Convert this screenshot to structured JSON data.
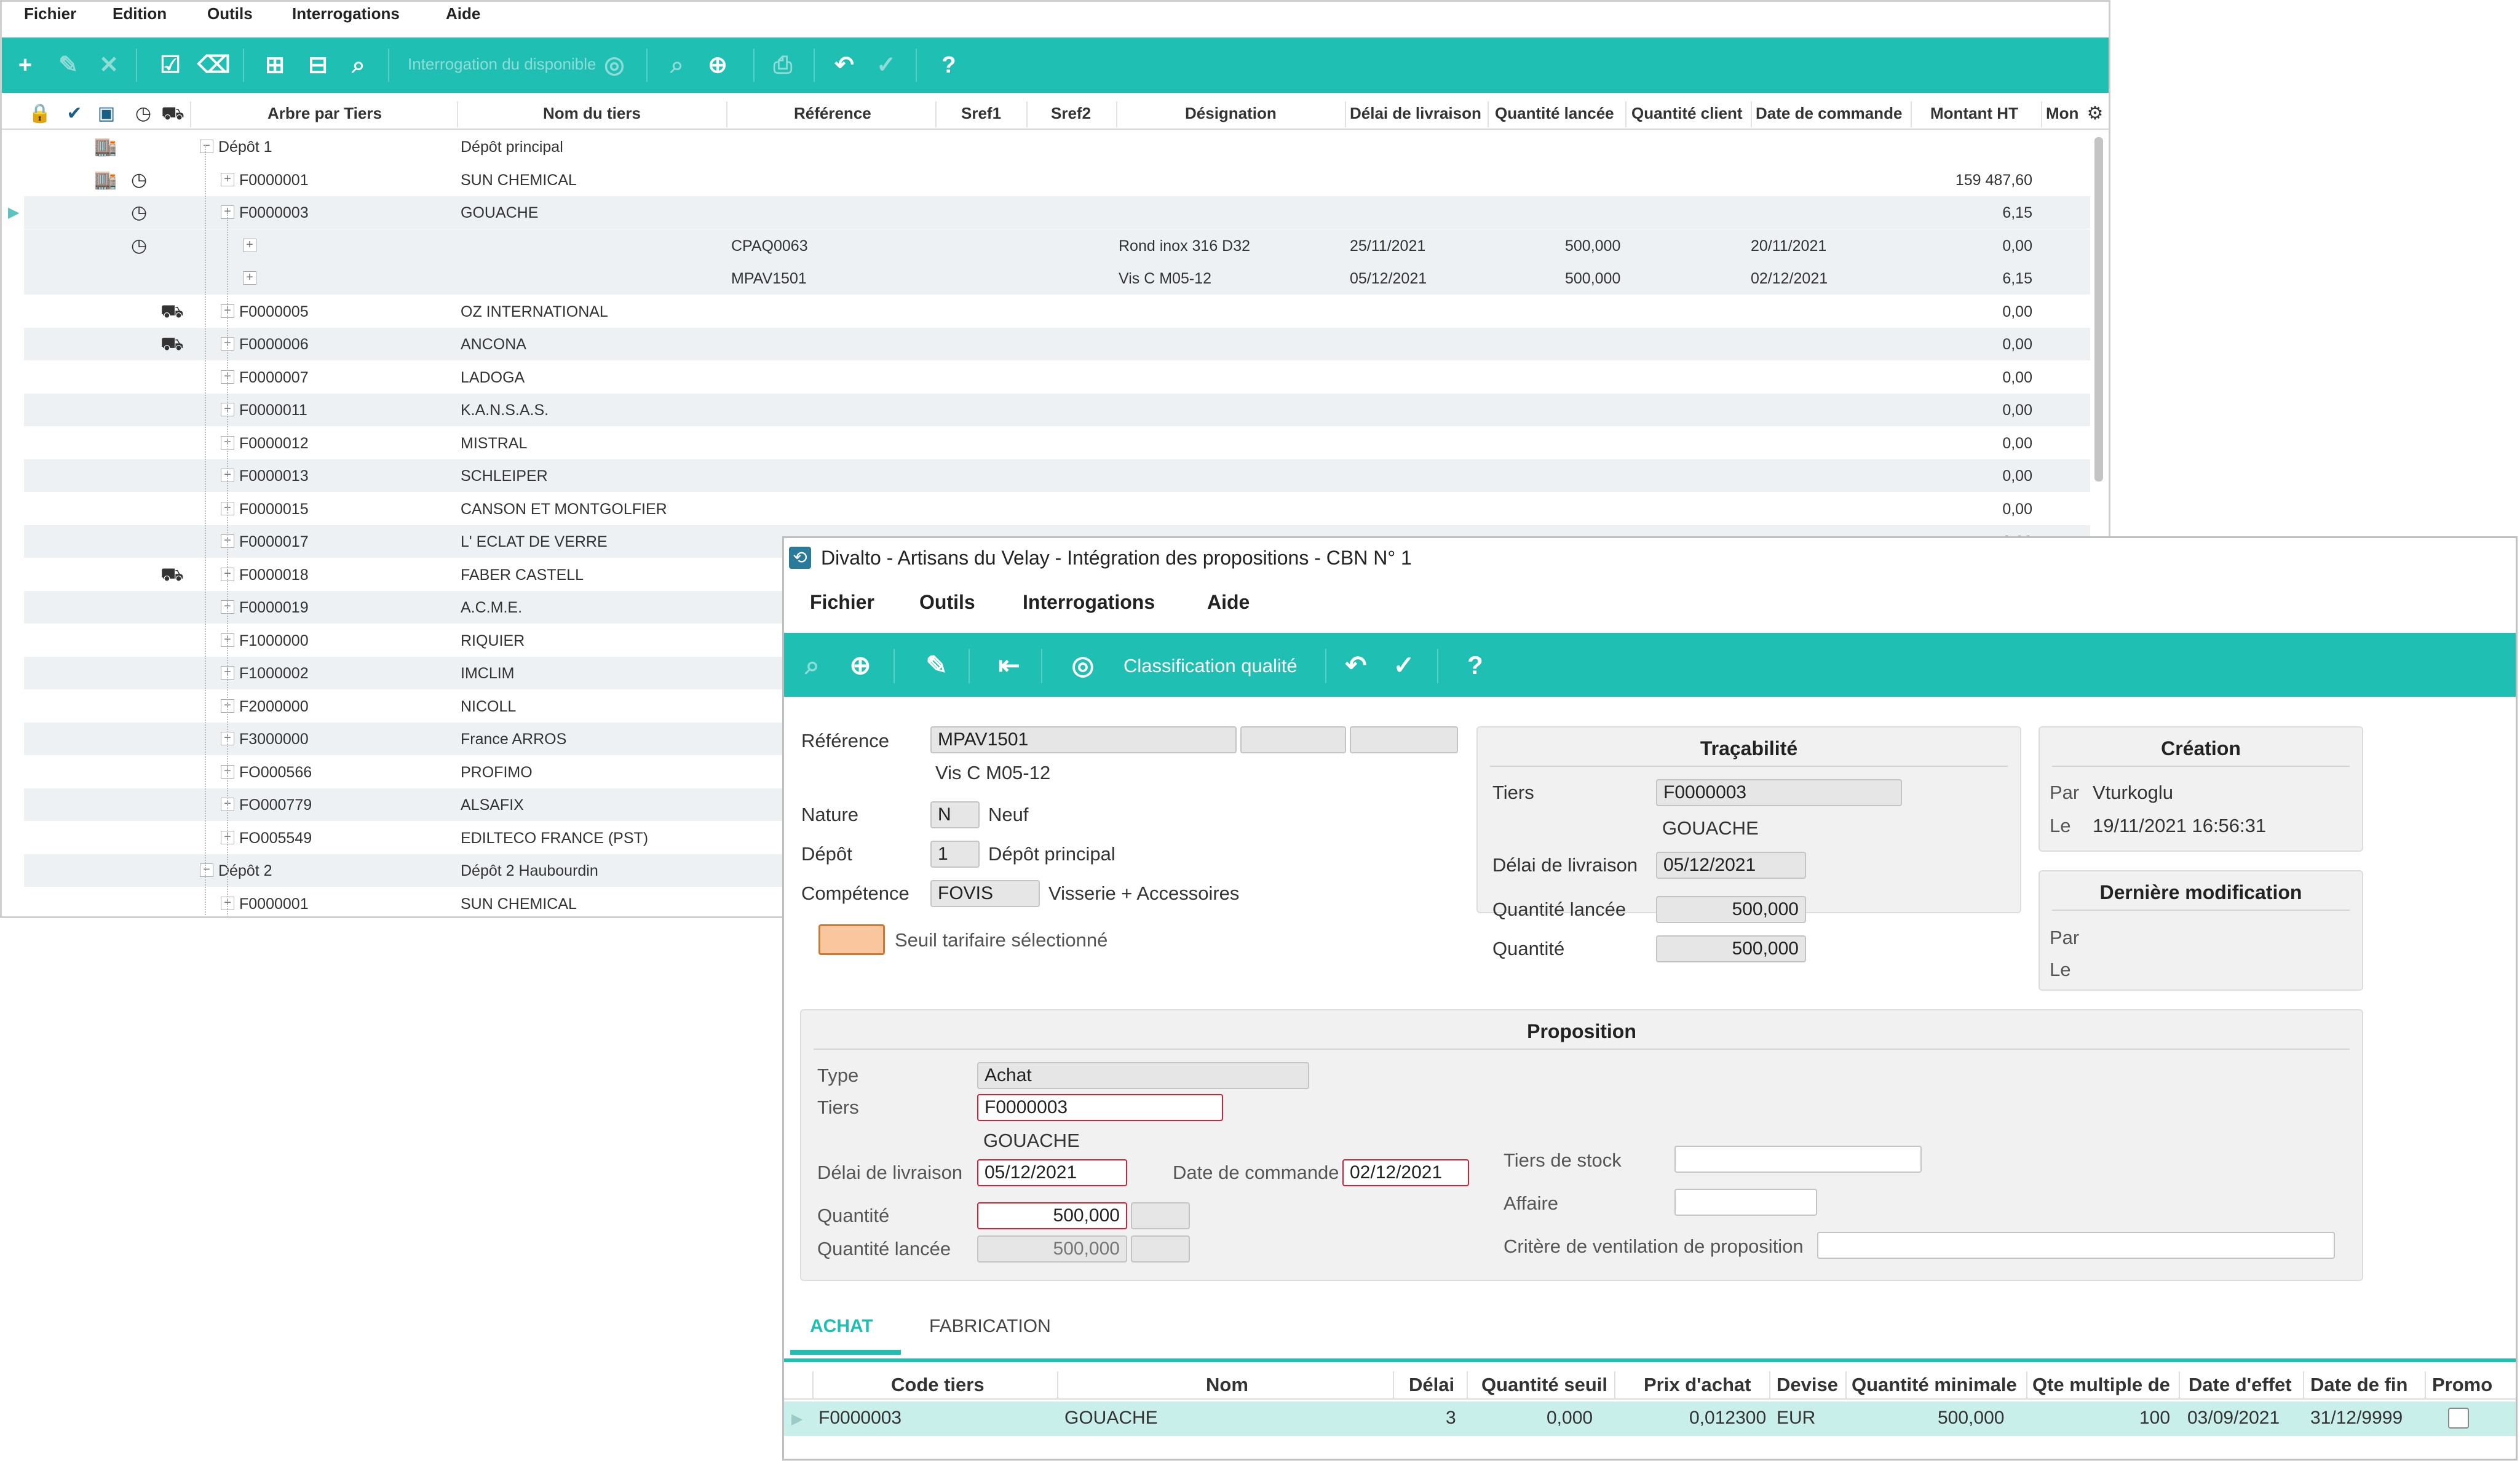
{
  "main_menu": [
    "Fichier",
    "Edition",
    "Outils",
    "Interrogations",
    "Aide"
  ],
  "main_toolbar": {
    "interrogation_label": "Interrogation du disponible"
  },
  "grid": {
    "columns": [
      "Arbre par Tiers",
      "Nom du tiers",
      "Référence",
      "Sref1",
      "Sref2",
      "Désignation",
      "Délai de livraison",
      "Quantité lancée",
      "Quantité client",
      "Date de commande",
      "Montant HT",
      "Mon"
    ],
    "rows": [
      {
        "code": "Dépôt 1",
        "name": "Dépôt principal",
        "ref": "",
        "des": "",
        "delai": "",
        "qte": "",
        "datecmd": "",
        "montant": ""
      },
      {
        "code": "F0000001",
        "name": "SUN CHEMICAL",
        "ref": "",
        "des": "",
        "delai": "",
        "qte": "",
        "datecmd": "",
        "montant": "159 487,60"
      },
      {
        "code": "F0000003",
        "name": "GOUACHE",
        "ref": "",
        "des": "",
        "delai": "",
        "qte": "",
        "datecmd": "",
        "montant": "6,15"
      },
      {
        "code": "",
        "name": "",
        "ref": "CPAQ0063",
        "des": "Rond inox 316 D32",
        "delai": "25/11/2021",
        "qte": "500,000",
        "datecmd": "20/11/2021",
        "montant": "0,00"
      },
      {
        "code": "",
        "name": "",
        "ref": "MPAV1501",
        "des": "Vis C M05-12",
        "delai": "05/12/2021",
        "qte": "500,000",
        "datecmd": "02/12/2021",
        "montant": "6,15"
      },
      {
        "code": "F0000005",
        "name": "OZ INTERNATIONAL",
        "ref": "",
        "des": "",
        "delai": "",
        "qte": "",
        "datecmd": "",
        "montant": "0,00"
      },
      {
        "code": "F0000006",
        "name": "ANCONA",
        "ref": "",
        "des": "",
        "delai": "",
        "qte": "",
        "datecmd": "",
        "montant": "0,00"
      },
      {
        "code": "F0000007",
        "name": "LADOGA",
        "ref": "",
        "des": "",
        "delai": "",
        "qte": "",
        "datecmd": "",
        "montant": "0,00"
      },
      {
        "code": "F0000011",
        "name": "K.A.N.S.A.S.",
        "ref": "",
        "des": "",
        "delai": "",
        "qte": "",
        "datecmd": "",
        "montant": "0,00"
      },
      {
        "code": "F0000012",
        "name": "MISTRAL",
        "ref": "",
        "des": "",
        "delai": "",
        "qte": "",
        "datecmd": "",
        "montant": "0,00"
      },
      {
        "code": "F0000013",
        "name": "SCHLEIPER",
        "ref": "",
        "des": "",
        "delai": "",
        "qte": "",
        "datecmd": "",
        "montant": "0,00"
      },
      {
        "code": "F0000015",
        "name": "CANSON ET MONTGOLFIER",
        "ref": "",
        "des": "",
        "delai": "",
        "qte": "",
        "datecmd": "",
        "montant": "0,00"
      },
      {
        "code": "F0000017",
        "name": "L' ECLAT DE VERRE",
        "ref": "",
        "des": "",
        "delai": "",
        "qte": "",
        "datecmd": "",
        "montant": "0,00"
      },
      {
        "code": "F0000018",
        "name": "FABER CASTELL",
        "ref": "",
        "des": "",
        "delai": "",
        "qte": "",
        "datecmd": "",
        "montant": ""
      },
      {
        "code": "F0000019",
        "name": "A.C.M.E.",
        "ref": "",
        "des": "",
        "delai": "",
        "qte": "",
        "datecmd": "",
        "montant": ""
      },
      {
        "code": "F1000000",
        "name": "RIQUIER",
        "ref": "",
        "des": "",
        "delai": "",
        "qte": "",
        "datecmd": "",
        "montant": ""
      },
      {
        "code": "F1000002",
        "name": "IMCLIM",
        "ref": "",
        "des": "",
        "delai": "",
        "qte": "",
        "datecmd": "",
        "montant": ""
      },
      {
        "code": "F2000000",
        "name": "NICOLL",
        "ref": "",
        "des": "",
        "delai": "",
        "qte": "",
        "datecmd": "",
        "montant": ""
      },
      {
        "code": "F3000000",
        "name": "France ARROS",
        "ref": "",
        "des": "",
        "delai": "",
        "qte": "",
        "datecmd": "",
        "montant": ""
      },
      {
        "code": "FO000566",
        "name": "PROFIMO",
        "ref": "",
        "des": "",
        "delai": "",
        "qte": "",
        "datecmd": "",
        "montant": ""
      },
      {
        "code": "FO000779",
        "name": "ALSAFIX",
        "ref": "",
        "des": "",
        "delai": "",
        "qte": "",
        "datecmd": "",
        "montant": ""
      },
      {
        "code": "FO005549",
        "name": "EDILTECO FRANCE (PST)",
        "ref": "",
        "des": "",
        "delai": "",
        "qte": "",
        "datecmd": "",
        "montant": ""
      },
      {
        "code": "Dépôt 2",
        "name": "Dépôt 2 Haubourdin",
        "ref": "",
        "des": "",
        "delai": "",
        "qte": "",
        "datecmd": "",
        "montant": ""
      },
      {
        "code": "F0000001",
        "name": "SUN CHEMICAL",
        "ref": "",
        "des": "",
        "delai": "",
        "qte": "",
        "datecmd": "",
        "montant": ""
      }
    ]
  },
  "dialog": {
    "title": "Divalto - Artisans du Velay - Intégration des propositions - CBN N° 1",
    "menu": [
      "Fichier",
      "Outils",
      "Interrogations",
      "Aide"
    ],
    "toolbar_label": "Classification qualité",
    "reference_label": "Référence",
    "reference_value": "MPAV1501",
    "designation": "Vis C M05-12",
    "nature_label": "Nature",
    "nature_code": "N",
    "nature_text": "Neuf",
    "depot_label": "Dépôt",
    "depot_code": "1",
    "depot_text": "Dépôt principal",
    "competence_label": "Compétence",
    "competence_code": "FOVIS",
    "competence_text": "Visserie + Accessoires",
    "seuil_text": "Seuil tarifaire sélectionné",
    "tracabilite": {
      "title": "Traçabilité",
      "tiers_label": "Tiers",
      "tiers_code": "F0000003",
      "tiers_name": "GOUACHE",
      "delai_label": "Délai de livraison",
      "delai_value": "05/12/2021",
      "qte_lancee_label": "Quantité lancée",
      "qte_lancee_value": "500,000",
      "qte_label": "Quantité",
      "qte_value": "500,000"
    },
    "creation": {
      "title": "Création",
      "par_label": "Par",
      "par_value": "Vturkoglu",
      "le_label": "Le",
      "le_value": "19/11/2021 16:56:31"
    },
    "modification": {
      "title": "Dernière modification",
      "par_label": "Par",
      "le_label": "Le"
    },
    "proposition": {
      "title": "Proposition",
      "type_label": "Type",
      "type_value": "Achat",
      "tiers_label": "Tiers",
      "tiers_value": "F0000003",
      "tiers_name": "GOUACHE",
      "delai_label": "Délai de livraison",
      "delai_value": "05/12/2021",
      "datecmd_label": "Date de commande",
      "datecmd_value": "02/12/2021",
      "qte_label": "Quantité",
      "qte_value": "500,000",
      "qte_lancee_label": "Quantité lancée",
      "qte_lancee_value": "500,000",
      "tiers_stock_label": "Tiers de stock",
      "affaire_label": "Affaire",
      "critere_label": "Critère de ventilation de proposition"
    },
    "tabs": [
      "ACHAT",
      "FABRICATION"
    ],
    "table": {
      "columns": [
        "Code tiers",
        "Nom",
        "Délai",
        "Quantité seuil",
        "Prix d'achat",
        "Devise",
        "Quantité minimale",
        "Qte multiple de",
        "Date d'effet",
        "Date de fin",
        "Promo"
      ],
      "row": {
        "code": "F0000003",
        "nom": "GOUACHE",
        "delai": "3",
        "seuil": "0,000",
        "prix": "0,012300",
        "devise": "EUR",
        "qmin": "500,000",
        "qmult": "100",
        "effet": "03/09/2021",
        "fin": "31/12/9999"
      }
    }
  },
  "colors": {
    "accent": "#1fbfb4",
    "error": "#d81f3a",
    "swatch": "#f9c69d"
  }
}
